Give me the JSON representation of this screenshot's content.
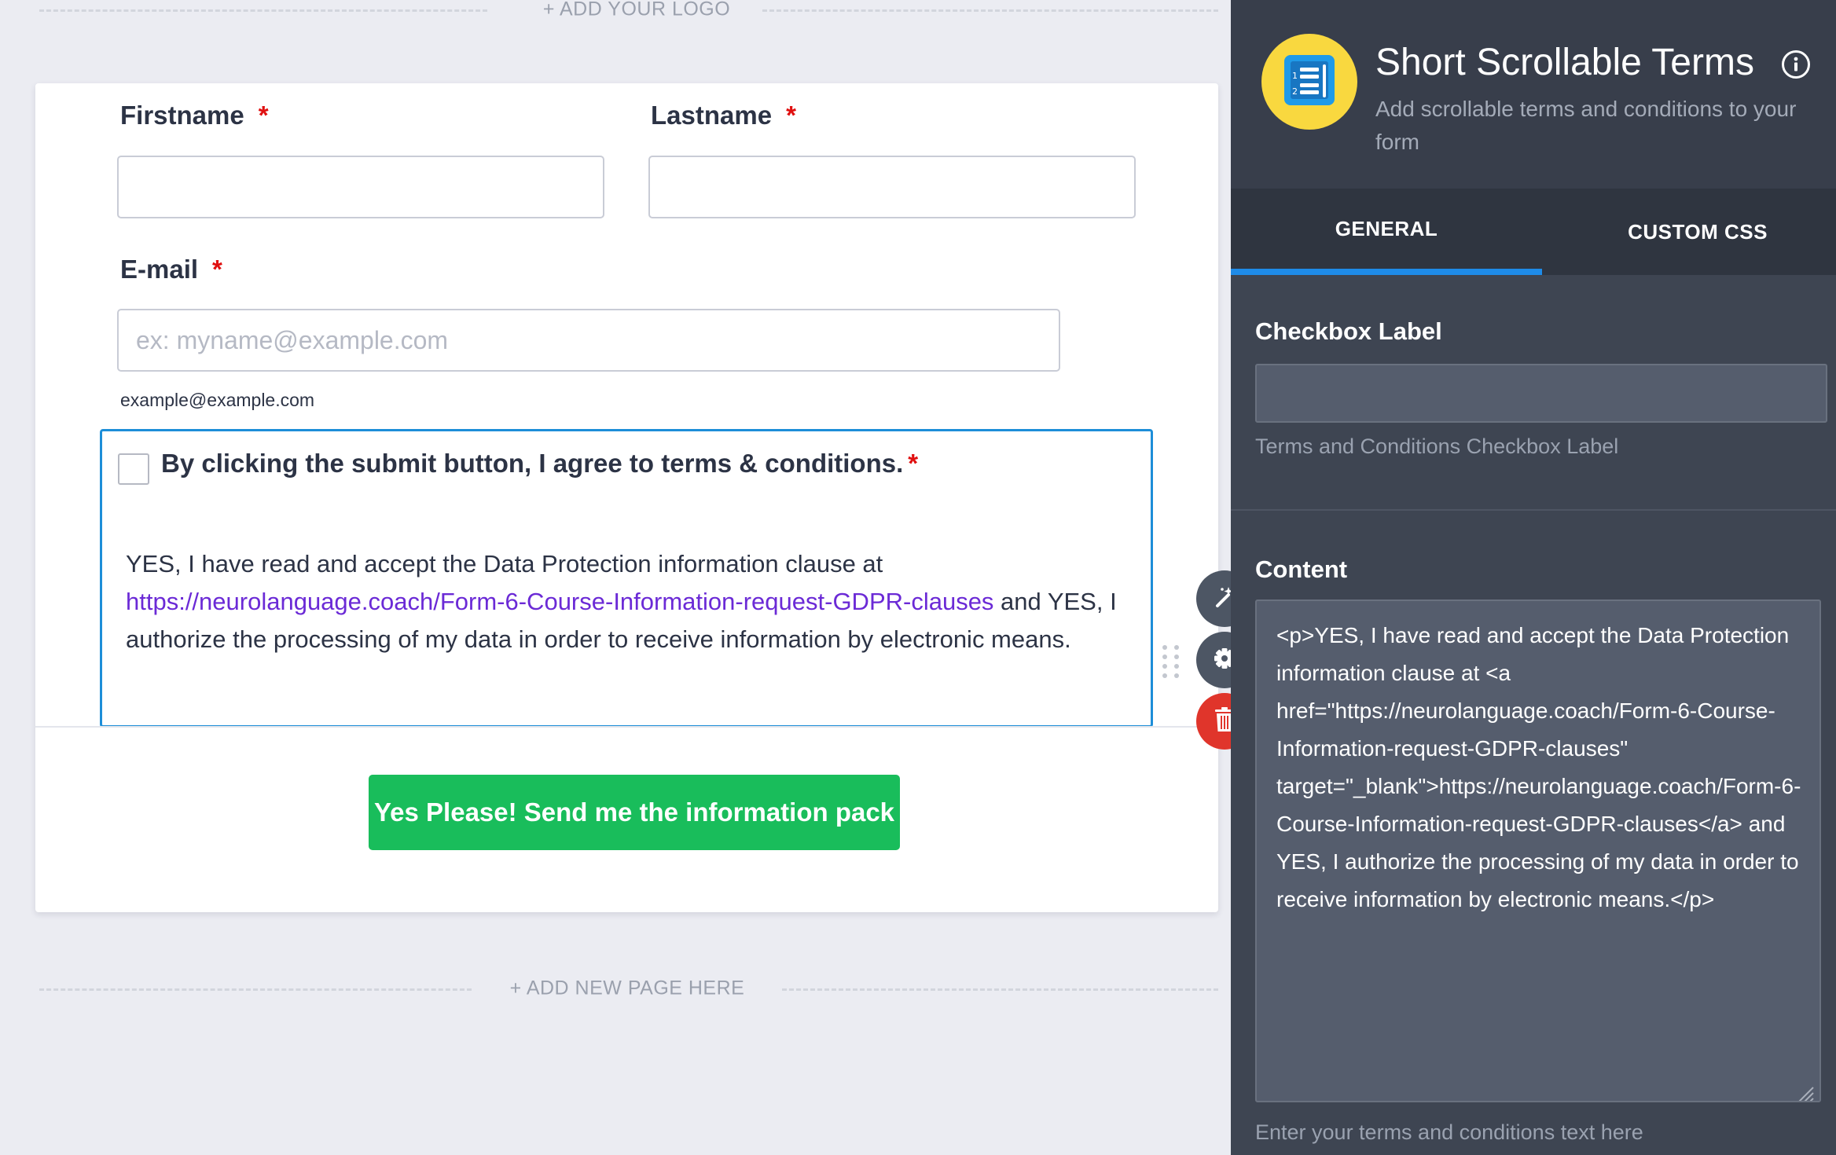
{
  "canvas": {
    "add_logo_label": "+ ADD YOUR LOGO",
    "add_page_label": "+ ADD NEW PAGE HERE"
  },
  "form": {
    "firstname": {
      "label": "Firstname",
      "required_mark": "*",
      "value": ""
    },
    "lastname": {
      "label": "Lastname",
      "required_mark": "*",
      "value": ""
    },
    "email": {
      "label": "E-mail",
      "required_mark": "*",
      "placeholder": "ex: myname@example.com",
      "sublabel": "example@example.com"
    },
    "terms": {
      "checkbox_label": "By clicking the submit button, I agree to terms & conditions.",
      "required_mark": "*",
      "checked": false,
      "text_before_link": "YES, I have read and accept the Data Protection information clause at ",
      "link_text": "https://neurolanguage.coach/Form-6-Course-Information-request-GDPR-clauses",
      "text_after_link": " and YES, I authorize the processing of my data in order to receive information by electronic means."
    },
    "submit_label": "Yes Please! Send me the information pack"
  },
  "field_tools": {
    "wand_icon": "magic-wand-icon",
    "gear_icon": "gear-icon",
    "trash_icon": "trash-icon",
    "drag_icon": "drag-handle-icon"
  },
  "panel": {
    "title": "Short Scrollable Terms",
    "subtitle": "Add scrollable terms and conditions to your form",
    "tabs": [
      {
        "label": "GENERAL",
        "active": true
      },
      {
        "label": "CUSTOM CSS",
        "active": false
      }
    ],
    "checkbox_label_section": {
      "title": "Checkbox Label",
      "value": "",
      "hint": "Terms and Conditions Checkbox Label"
    },
    "content_section": {
      "title": "Content",
      "value": "<p>YES, I have read and accept the Data Protection information clause at <a href=\"https://neurolanguage.coach/Form-6-Course-Information-request-GDPR-clauses\" target=\"_blank\">https://neurolanguage.coach/Form-6-Course-Information-request-GDPR-clauses</a> and YES, I authorize the processing of my data in order to receive information by electronic means.</p>",
      "hint": "Enter your terms and conditions text here"
    }
  },
  "colors": {
    "accent_blue": "#1e8be8",
    "submit_green": "#19bd5b",
    "required_red": "#e01010",
    "link_purple": "#6b2ad6",
    "delete_red": "#e0352b"
  }
}
